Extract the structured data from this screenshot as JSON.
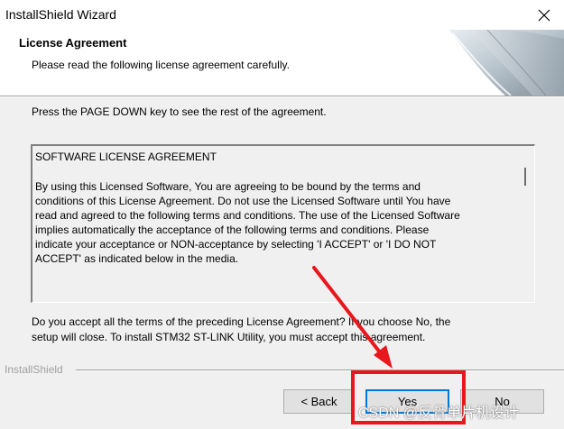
{
  "window": {
    "title": "InstallShield Wizard",
    "close_glyph": "✕"
  },
  "header": {
    "title": "License Agreement",
    "subtitle": "Please read the following license agreement carefully."
  },
  "instruction": "Press the PAGE DOWN key to see the rest of the agreement.",
  "license": {
    "heading": "SOFTWARE LICENSE AGREEMENT",
    "body": "By using this Licensed Software, You are agreeing to be bound by the terms and\nconditions of this License Agreement. Do not use the Licensed Software until You have\nread and agreed to the following terms and conditions. The use of the Licensed Software\nimplies automatically the acceptance of the following terms and conditions. Please\nindicate your acceptance or NON-acceptance by selecting 'I ACCEPT' or 'I DO NOT\nACCEPT' as indicated below in the media."
  },
  "question": "Do you accept all the terms of the preceding License Agreement?  If you choose No,  the\nsetup will close.  To install STM32 ST-LINK Utility, you must accept this agreement.",
  "brand": "InstallShield",
  "buttons": {
    "back": "< Back",
    "yes": "Yes",
    "no": "No"
  },
  "watermark": "CSDN @反骨单片机设计",
  "colors": {
    "highlight": "#e8161d",
    "focus_border": "#0078d7"
  }
}
